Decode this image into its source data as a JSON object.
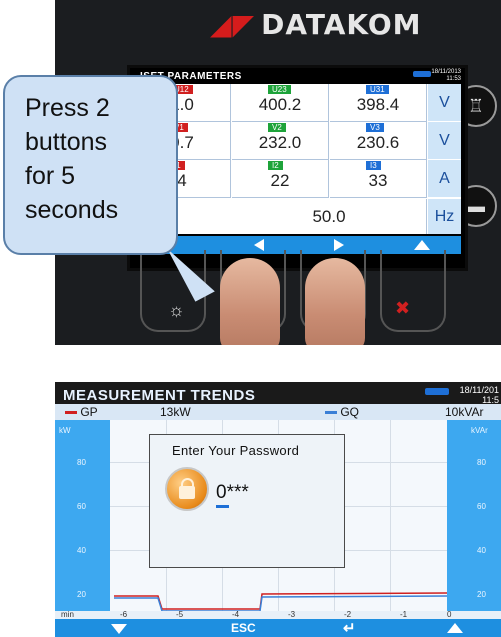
{
  "top_photo": {
    "brand": "DATAKOM",
    "screen_title": "MAINS PARAMETERS",
    "screen_title_visible": "ISET PARAMETERS",
    "date": "18/11/2013",
    "time": "11:53",
    "rows": [
      {
        "cells": [
          {
            "tag": "U12",
            "value": "1.0",
            "color": "#d12020"
          },
          {
            "tag": "U23",
            "value": "400.2",
            "color": "#1ea33a"
          },
          {
            "tag": "U31",
            "value": "398.4",
            "color": "#1e6fd6"
          }
        ],
        "unit": "V"
      },
      {
        "cells": [
          {
            "tag": "V1",
            "value": "0.7",
            "color": "#d12020"
          },
          {
            "tag": "V2",
            "value": "232.0",
            "color": "#1ea33a"
          },
          {
            "tag": "V3",
            "value": "230.6",
            "color": "#1e6fd6"
          }
        ],
        "unit": "V"
      },
      {
        "cells": [
          {
            "tag": "I1",
            "value": "4",
            "color": "#d12020"
          },
          {
            "tag": "I2",
            "value": "22",
            "color": "#1ea33a"
          },
          {
            "tag": "I3",
            "value": "33",
            "color": "#1e6fd6"
          }
        ],
        "unit": "A"
      },
      {
        "frequency": "50.0",
        "unit": "Hz"
      }
    ],
    "callout": "Press 2\nbuttons\nfor 5\nseconds"
  },
  "bottom_screen": {
    "title": "MEASUREMENT  TRENDS",
    "date": "18/11/201",
    "time": "11:5",
    "legend": [
      {
        "name": "GP",
        "value": "13kW",
        "color": "#d02020"
      },
      {
        "name": "GQ",
        "value": "10kVAr",
        "color": "#3a7fd6"
      }
    ],
    "left_unit": "kW",
    "right_unit": "kVAr",
    "y_ticks": [
      "80",
      "60",
      "40",
      "20"
    ],
    "x_label": "min",
    "x_ticks": [
      "-6",
      "-5",
      "-4",
      "-3",
      "-2",
      "-1",
      "0"
    ],
    "dialog": {
      "prompt": "Enter Your Password",
      "password_display": "0***"
    },
    "nav": {
      "esc_label": "ESC"
    }
  }
}
